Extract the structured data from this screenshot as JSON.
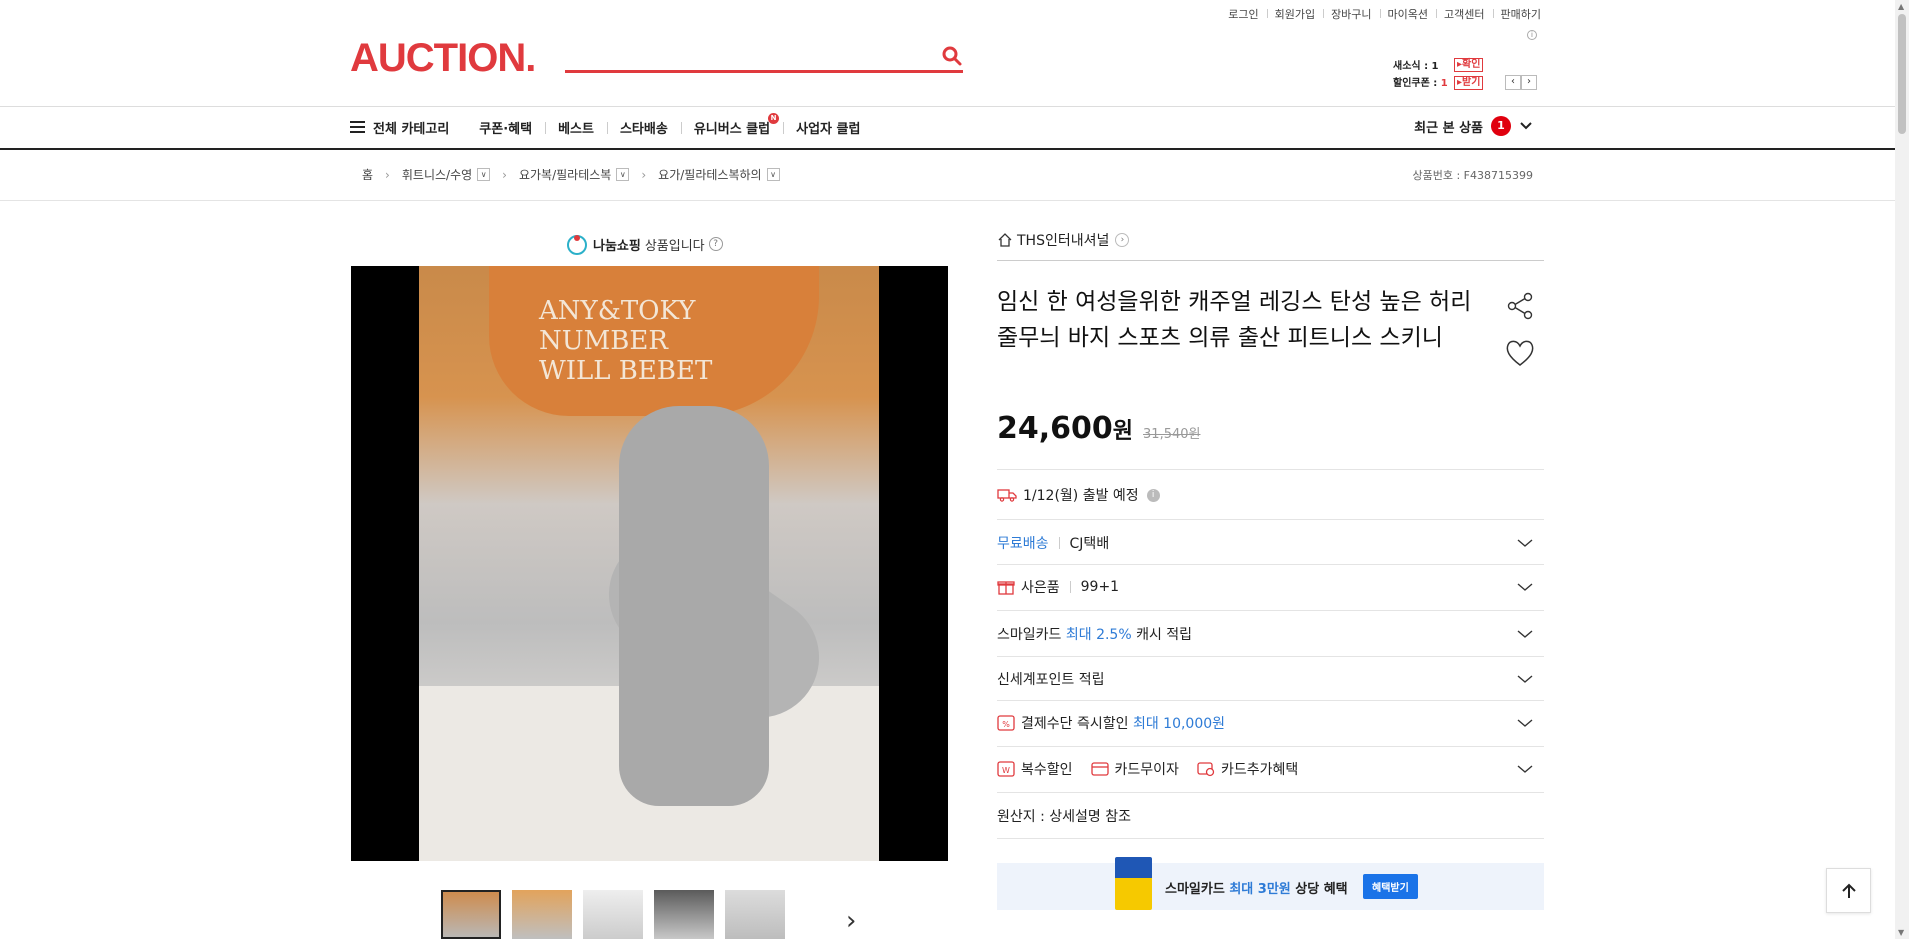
{
  "util_links": [
    "로그인",
    "회원가입",
    "장바구니",
    "마이옥션",
    "고객센터",
    "판매하기"
  ],
  "logo": "AUCTION.",
  "search": {
    "placeholder": ""
  },
  "mini_info": {
    "news_label": "새소식 : 1",
    "news_btn": "확인",
    "coupon_label": "할인쿠폰 : ",
    "coupon_count": "1",
    "coupon_btn": "받기"
  },
  "nav": {
    "all_categories": "전체 카테고리",
    "items": [
      "쿠폰·혜택",
      "베스트",
      "스타배송",
      "유니버스 클럽",
      "사업자 클럽"
    ],
    "new_badge": "N",
    "recent_label": "최근 본 상품",
    "recent_count": "1"
  },
  "breadcrumb": {
    "home": "홈",
    "items": [
      "휘트니스/수영",
      "요가복/필라테스복",
      "요가/필라테스복하의"
    ]
  },
  "product_no": "상품번호 : F438715399",
  "nanum": {
    "brand": "나눔쇼핑",
    "suffix": "상품입니다"
  },
  "image_text": "ANY&TOKY\nNUMBER\nWILL BEBET",
  "seller": "THS인터내셔널",
  "title": "임신 한 여성을위한 캐주얼 레깅스 탄성 높은 허리 줄무늬 바지 스포츠 의류 출산 피트니스 스키니",
  "price": {
    "current": "24,600",
    "unit": "원",
    "original": "31,540원"
  },
  "shipping_date": "1/12(월) 출발 예정",
  "rows": {
    "delivery_free": "무료배송",
    "delivery_carrier": "CJ택배",
    "gift_label": "사은품",
    "gift_value": "99+1",
    "smilecard_a": "스마일카드 ",
    "smilecard_b": "최대 2.5%",
    "smilecard_c": " 캐시 적립",
    "shinsegae": "신세계포인트 적립",
    "payment_a": "결제수단 즉시할인 ",
    "payment_b": "최대 10,000원",
    "multi_discount": "복수할인",
    "card_noint": "카드무이자",
    "card_extra": "카드추가혜택",
    "origin": "원산지 : 상세설명 참조"
  },
  "banner": {
    "text_a": "스마일카드 ",
    "text_b": "최대 3만원",
    "text_c": " 상당 혜택",
    "button": "혜택받기"
  },
  "colors": {
    "brand": "#e03a3e",
    "accent_blue": "#2e7bd6",
    "badge_red": "#e0000e"
  }
}
